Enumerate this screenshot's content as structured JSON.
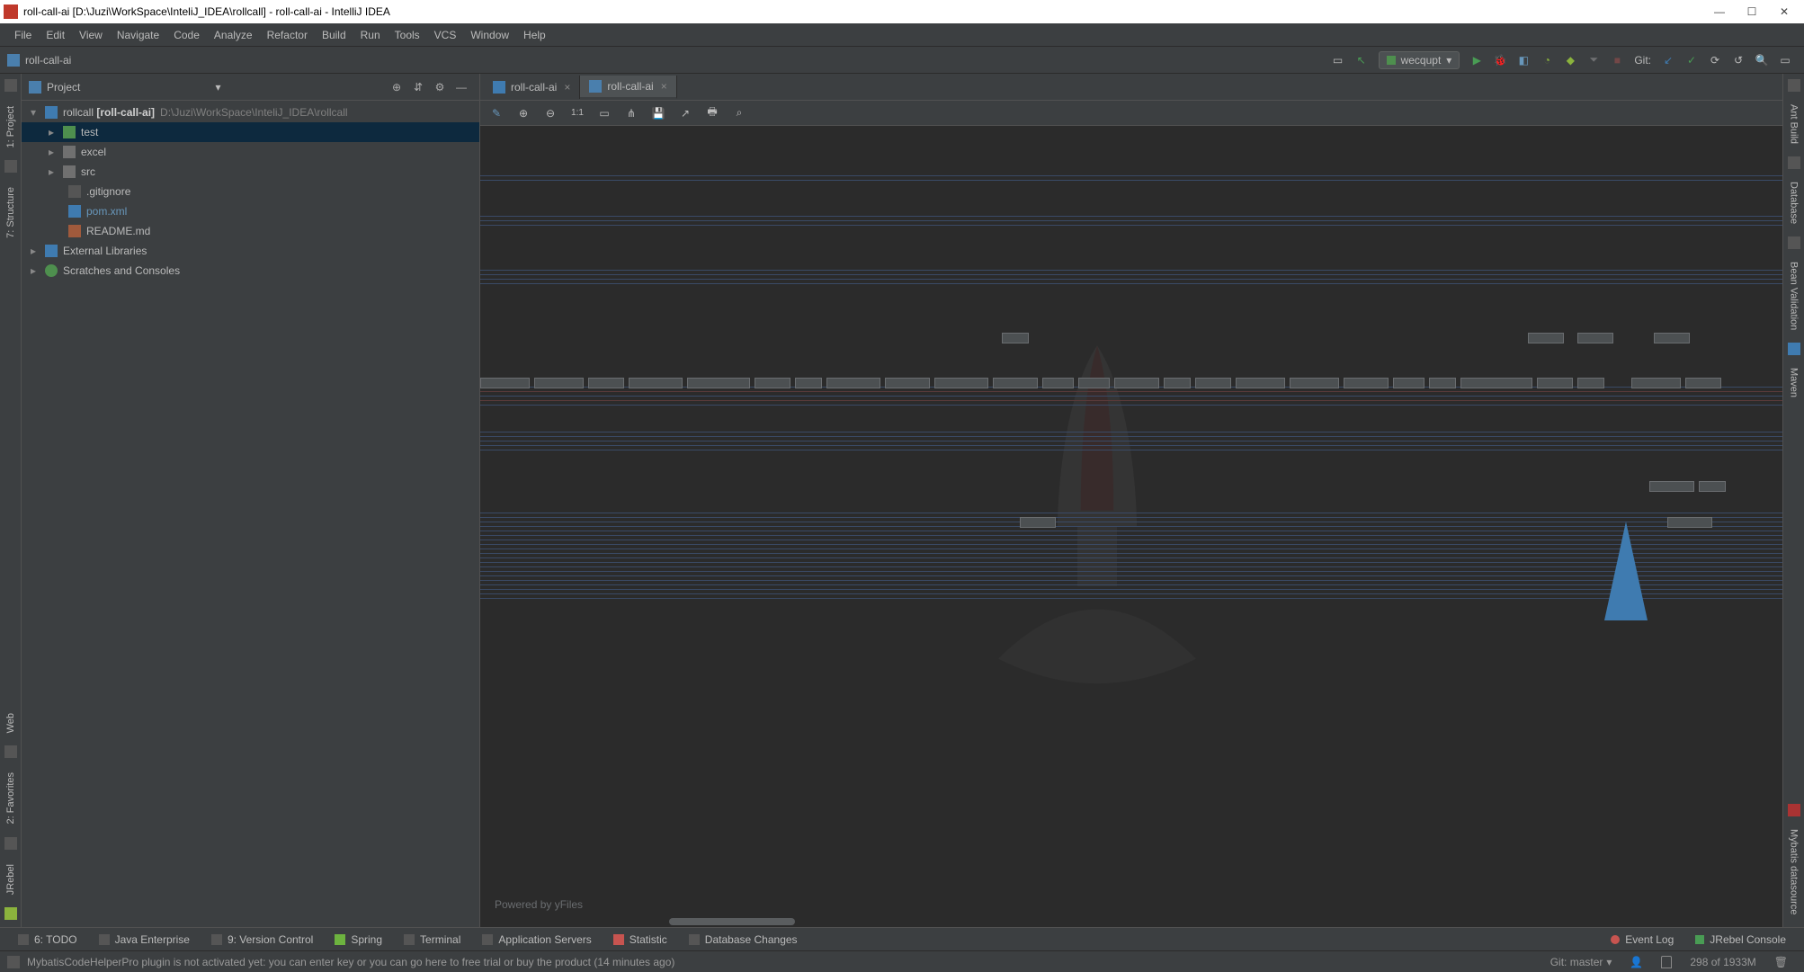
{
  "window": {
    "title": "roll-call-ai [D:\\Juzi\\WorkSpace\\InteliJ_IDEA\\rollcall] - roll-call-ai - IntelliJ IDEA"
  },
  "menu": [
    "File",
    "Edit",
    "View",
    "Navigate",
    "Code",
    "Analyze",
    "Refactor",
    "Build",
    "Run",
    "Tools",
    "VCS",
    "Window",
    "Help"
  ],
  "breadcrumb": "roll-call-ai",
  "run_config": "wecqupt",
  "git_label": "Git:",
  "project_panel": {
    "title": "Project",
    "tree": {
      "root_label": "rollcall",
      "root_bold": "[roll-call-ai]",
      "root_path": "D:\\Juzi\\WorkSpace\\InteliJ_IDEA\\rollcall",
      "children": [
        "test",
        "excel",
        "src",
        ".gitignore",
        "pom.xml",
        "README.md"
      ],
      "external": "External Libraries",
      "scratches": "Scratches and Consoles"
    }
  },
  "left_tabs": [
    "1: Project",
    "7: Structure"
  ],
  "left_bottom_tabs": [
    "Web",
    "2: Favorites",
    "JRebel"
  ],
  "right_tabs": [
    "Ant Build",
    "Database",
    "Bean Validation",
    "Maven",
    "Mybatis datasource"
  ],
  "editor_tabs": [
    {
      "label": "roll-call-ai",
      "icon": "m",
      "active": false
    },
    {
      "label": "roll-call-ai",
      "icon": "d",
      "active": true
    }
  ],
  "editor_toolbar_11": "1:1",
  "diagram": {
    "powered": "Powered by yFiles"
  },
  "bottom_tabs": [
    "6: TODO",
    "Java Enterprise",
    "9: Version Control",
    "Spring",
    "Terminal",
    "Application Servers",
    "Statistic",
    "Database Changes"
  ],
  "bottom_right": {
    "event_log": "Event Log",
    "jrebel": "JRebel Console"
  },
  "status": {
    "msg": "MybatisCodeHelperPro plugin is not activated yet: you can enter key or you can go here to free trial or buy the product (14 minutes ago)",
    "git": "Git: master",
    "mem": "298 of 1933M"
  }
}
